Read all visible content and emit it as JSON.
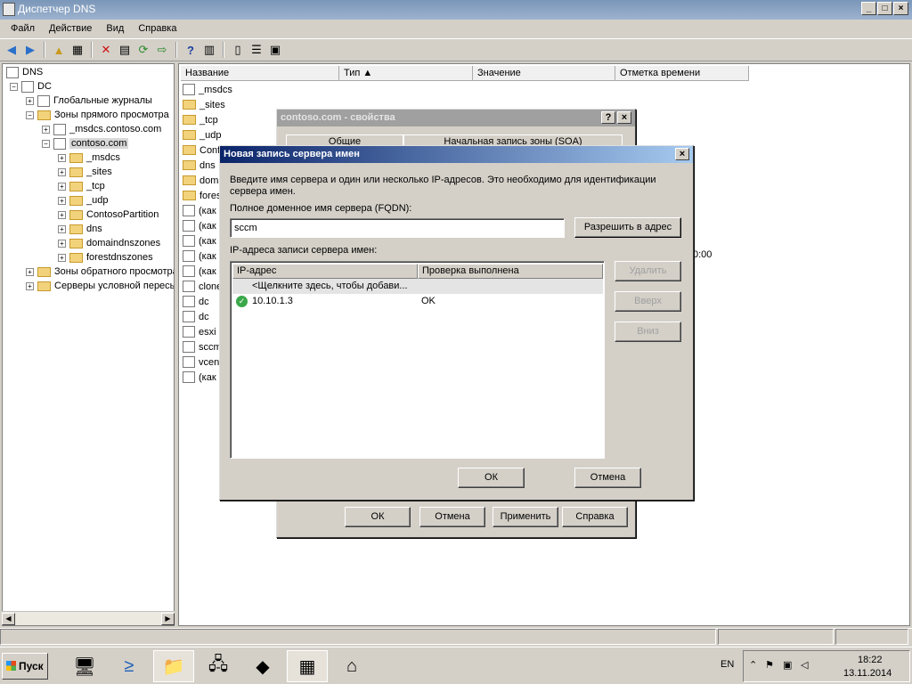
{
  "window": {
    "title": "Диспетчер DNS",
    "min": "_",
    "max": "□",
    "close": "×"
  },
  "menu": [
    "Файл",
    "Действие",
    "Вид",
    "Справка"
  ],
  "tree": {
    "root": "DNS",
    "server": "DC",
    "items": [
      {
        "label": "Глобальные журналы"
      },
      {
        "label": "Зоны прямого просмотра"
      },
      {
        "label": "_msdcs.contoso.com"
      },
      {
        "label": "contoso.com"
      },
      {
        "label": "_msdcs"
      },
      {
        "label": "_sites"
      },
      {
        "label": "_tcp"
      },
      {
        "label": "_udp"
      },
      {
        "label": "ContosoPartition"
      },
      {
        "label": "dns"
      },
      {
        "label": "domaindnszones"
      },
      {
        "label": "forestdnszones"
      },
      {
        "label": "Зоны обратного просмотра"
      },
      {
        "label": "Серверы условной пересылки"
      }
    ]
  },
  "list": {
    "columns": [
      "Название",
      "Тип",
      "Значение",
      "Отметка времени"
    ],
    "items": [
      "_msdcs",
      "_sites",
      "_tcp",
      "_udp",
      "Conf",
      "dns",
      "doma",
      "fores",
      "(как",
      "(как",
      "(как",
      "(как",
      "(как",
      "clone",
      "dc",
      "dc",
      "esxi",
      "sccm",
      "vcen",
      "(как"
    ],
    "partial_time": "0:00"
  },
  "props_dialog": {
    "title": "contoso.com - свойства",
    "tab1": "Общие",
    "tab2": "Начальная запись зоны (SOA)",
    "ok": "ОК",
    "cancel": "Отмена",
    "apply": "Применить",
    "help": "Справка"
  },
  "ns_dialog": {
    "title": "Новая запись сервера имен",
    "intro": "Введите имя сервера и один или несколько IP-адресов.  Это необходимо для идентификации сервера имен.",
    "fqdn_label": "Полное доменное имя сервера (FQDN):",
    "fqdn_value": "sccm",
    "resolve": "Разрешить в адрес",
    "ip_label": "IP-адреса записи сервера имен:",
    "grid_cols": [
      "IP-адрес",
      "Проверка выполнена"
    ],
    "placeholder_row": "<Щелкните здесь, чтобы добави...",
    "rows": [
      {
        "ip": "10.10.1.3",
        "check": "OK"
      }
    ],
    "delete": "Удалить",
    "up": "Вверх",
    "down": "Вниз",
    "ok": "ОК",
    "cancel": "Отмена"
  },
  "taskbar": {
    "start": "Пуск",
    "lang": "EN",
    "time": "18:22",
    "date": "13.11.2014"
  },
  "colors": {
    "title_active": "#0a246a",
    "title_inactive": "#808080",
    "folder": "#f2d37c",
    "ok_green": "#3aa84a"
  }
}
